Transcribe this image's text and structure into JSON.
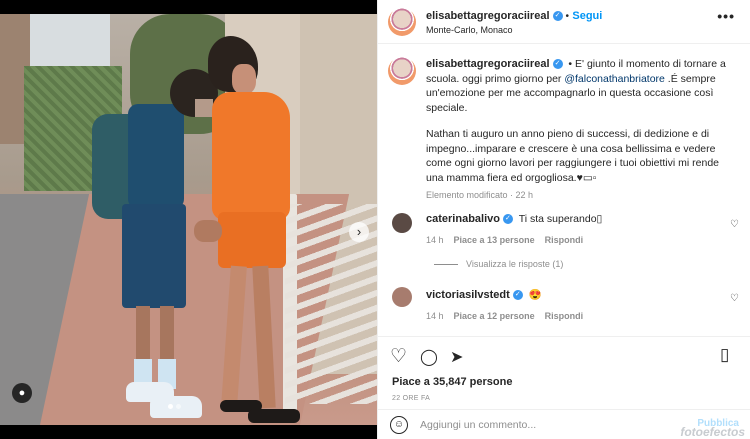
{
  "post": {
    "username": "elisabettagregoraciireal",
    "follow_label": "Segui",
    "location": "Monte-Carlo, Monaco",
    "more_label": "•••"
  },
  "caption": {
    "username": "elisabettagregoraciireal",
    "text_part1": " • E' giunto il momento di tornare a scuola. oggi primo giorno per ",
    "mention": "@falconathanbriatore",
    "text_part2": " .É sempre un'emozione per me accompagnarlo in questa occasione così speciale.",
    "paragraph2": "Nathan ti auguro un anno pieno di successi, di dedizione e di impegno...imparare e crescere è una cosa bellissima e vedere come ogni giorno lavori per raggiungere i tuoi obiettivi mi rende una mamma fiera ed orgogliosa.♥▭▫",
    "meta": "Elemento modificato · 22 h"
  },
  "comments": [
    {
      "username": "caterinabalivo",
      "text": "Ti sta superando▯",
      "time": "14 h",
      "likes": "Piace a 13 persone",
      "reply": "Rispondi"
    },
    {
      "username": "victoriasilvstedt",
      "text": "😍",
      "time": "14 h",
      "likes": "Piace a 12 persone",
      "reply": "Rispondi"
    }
  ],
  "view_replies": "Visualizza le risposte (1)",
  "likes_total": "Piace a 35,847 persone",
  "time_ago": "22 ORE FA",
  "add_comment": {
    "placeholder": "Aggiungi un commento...",
    "publish_label": "Pubblica"
  },
  "watermark": "fotoefectos",
  "icons": {
    "heart": "heart-icon",
    "comment": "comment-icon",
    "share": "share-icon",
    "save": "bookmark-icon",
    "emoji": "emoji-icon"
  },
  "colors": {
    "accent": "#0095f6",
    "verified": "#3897f0",
    "mention": "#00376b",
    "dress": "#f0782a"
  }
}
